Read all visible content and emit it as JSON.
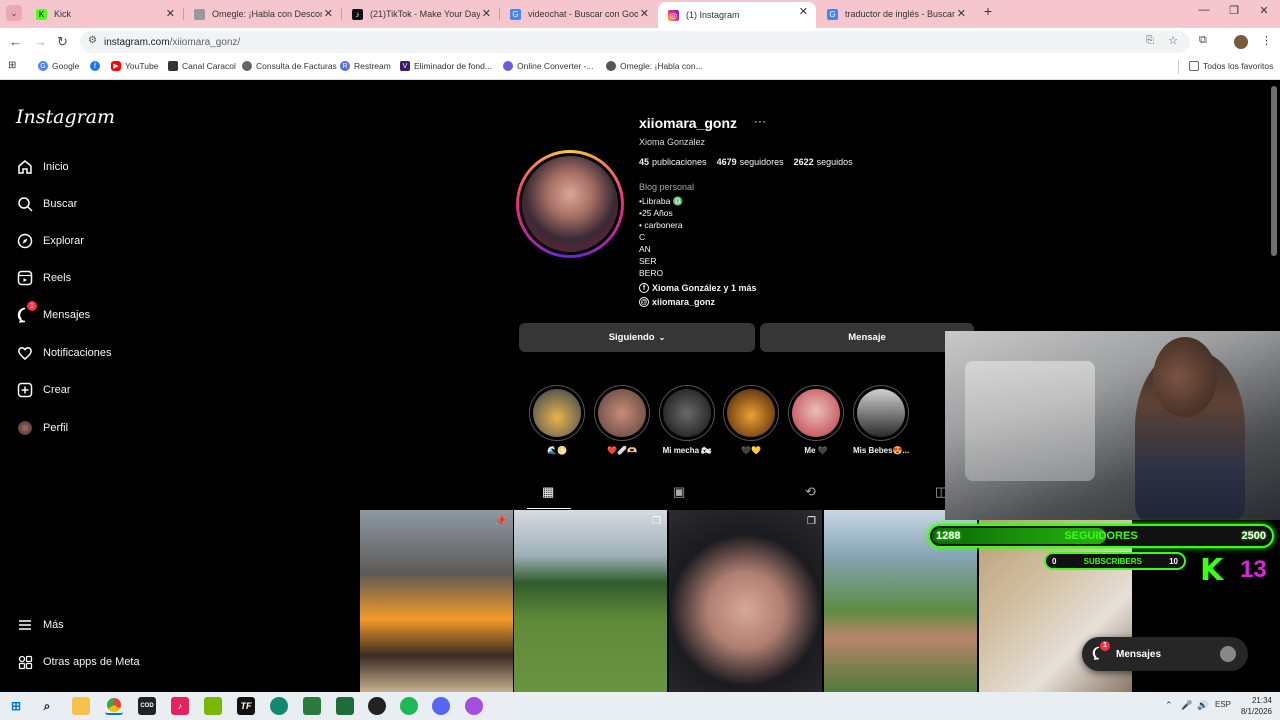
{
  "browser": {
    "tabs": [
      {
        "title": "Kick",
        "fav": "K",
        "color": "#53fc18"
      },
      {
        "title": "Omegle: ¡Habla con Desconoc...",
        "fav": "",
        "color": "#888888"
      },
      {
        "title": "(21)TikTok - Make Your Day",
        "fav": "♪",
        "color": "#111111"
      },
      {
        "title": "videochat - Buscar con Google",
        "fav": "G",
        "color": "#4285f4"
      },
      {
        "title": "(1) Instagram",
        "fav": "◎",
        "color": "#d6249f"
      },
      {
        "title": "traductor de inglés - Buscar co...",
        "fav": "G",
        "color": "#4285f4"
      }
    ],
    "url_host": "instagram.com",
    "url_path": "/xiiomara_gonz/",
    "bookmarks": [
      "Google",
      "YouTube",
      "Canal Caracol",
      "Consulta de Facturas",
      "Restream",
      "Eliminador de fond...",
      "Online Converter -...",
      "Omegle: ¡Habla con..."
    ],
    "all_bookmarks": "Todos los favoritos"
  },
  "sidebar": {
    "logo": "Instagram",
    "items": [
      {
        "label": "Inicio",
        "icon": "home-icon"
      },
      {
        "label": "Buscar",
        "icon": "search-icon"
      },
      {
        "label": "Explorar",
        "icon": "compass-icon"
      },
      {
        "label": "Reels",
        "icon": "reels-icon"
      },
      {
        "label": "Mensajes",
        "icon": "messenger-icon",
        "badge": "1"
      },
      {
        "label": "Notificaciones",
        "icon": "heart-icon"
      },
      {
        "label": "Crear",
        "icon": "plus-icon"
      },
      {
        "label": "Perfil",
        "icon": "avatar-icon"
      }
    ],
    "more": "Más",
    "meta_apps": "Otras apps de Meta"
  },
  "profile": {
    "username": "xiiomara_gonz",
    "more": "···",
    "full_name": "Xioma González",
    "posts_count": "45",
    "posts_label": "publicaciones",
    "followers_count": "4679",
    "followers_label": "seguidores",
    "following_count": "2622",
    "following_label": "seguidos",
    "category": "Blog personal",
    "bio_lines": [
      "•Libraba ♎",
      "•25 Años",
      "• carbonera",
      "C",
      "AN",
      "SER",
      "BERO"
    ],
    "link_text": "Xioma González y 1 más",
    "threads_text": "xiiomara_gonz",
    "following_btn": "Siguiendo",
    "message_btn": "Mensaje"
  },
  "highlights": [
    {
      "label": "🌊🌕",
      "c1": "#e9b54a",
      "c2": "#2d3d52"
    },
    {
      "label": "❤️🩹🫶🏻",
      "c1": "#c98c7a",
      "c2": "#5a3f3a"
    },
    {
      "label": "Mi mecha 🏍",
      "c1": "#3b3b3b",
      "c2": "#111111"
    },
    {
      "label": "🖤💛",
      "c1": "#d9751e",
      "c2": "#3a1a08"
    },
    {
      "label": "Me 🖤",
      "c1": "#c03848",
      "c2": "#e8c0b8"
    },
    {
      "label": "Mis Bebes😍...",
      "c1": "#d0d0d0",
      "c2": "#2a2a2a"
    }
  ],
  "post_tabs": [
    "grid-icon",
    "reels-icon",
    "tagged-repost-icon",
    "tagged-icon"
  ],
  "posts": [
    {
      "name": "post-1",
      "mark": "📌",
      "bg": "linear-gradient(180deg,#8f9aa3 0%,#5d5a57 35%,#f49a2a 60%,#3a2a22 80%,#c6b08f 100%)"
    },
    {
      "name": "post-2",
      "mark": "",
      "bg": "linear-gradient(180deg,#d6dbe0 0%,#9fb0b8 25%,#2f5b2a 40%,#5f8a3a 60%,#6a9440 100%)"
    },
    {
      "name": "post-3",
      "mark": "❐",
      "bg": "radial-gradient(circle at 50% 55%,#d6a89a 0%,#b07f72 30%,#1b1b1f 60%,#2b2b30 100%)"
    },
    {
      "name": "post-4",
      "mark": "",
      "bg": "linear-gradient(180deg,#c8d8e4 0%,#87a5b5 25%,#5c8c42 55%,#b9856b 70%,#4f7a3a 100%)"
    },
    {
      "name": "post-5",
      "mark": "",
      "bg": "linear-gradient(135deg,#b89b74 0%,#d2c0a2 40%,#e6e0d8 70%,#8b7766 100%)"
    }
  ],
  "stream": {
    "followers_current": "1288",
    "followers_label": "SEGUIDORES",
    "followers_goal": "2500",
    "followers_progress": 0.515,
    "subs_current": "0",
    "subs_label": "SUBSCRIBERS",
    "subs_goal": "10",
    "kick_logo": "K",
    "kick_number": "13"
  },
  "messages_pill": {
    "label": "Mensajes",
    "badge": "1"
  },
  "taskbar": {
    "time": "21:34",
    "date": "8/1/2026",
    "lang": "ESP"
  }
}
